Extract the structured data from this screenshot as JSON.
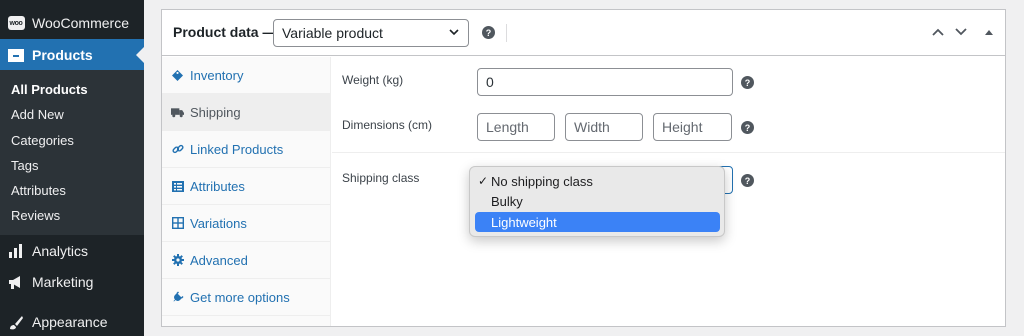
{
  "sidebar": {
    "woocommerce": "WooCommerce",
    "woo_logo_text": "woo",
    "products": "Products",
    "submenu": [
      "All Products",
      "Add New",
      "Categories",
      "Tags",
      "Attributes",
      "Reviews"
    ],
    "analytics": "Analytics",
    "marketing": "Marketing",
    "appearance": "Appearance",
    "active_color": "#2271b1"
  },
  "product_data": {
    "title": "Product data —",
    "type_value": "Variable product",
    "help": "?"
  },
  "tabs": [
    {
      "label": "Inventory",
      "icon": "tag-icon"
    },
    {
      "label": "Shipping",
      "icon": "truck-icon"
    },
    {
      "label": "Linked Products",
      "icon": "link-icon"
    },
    {
      "label": "Attributes",
      "icon": "list-icon"
    },
    {
      "label": "Variations",
      "icon": "grid-icon"
    },
    {
      "label": "Advanced",
      "icon": "gear-icon"
    },
    {
      "label": "Get more options",
      "icon": "plug-icon"
    }
  ],
  "shipping": {
    "weight_label": "Weight (kg)",
    "weight_value": "0",
    "dimensions_label": "Dimensions (cm)",
    "length_placeholder": "Length",
    "width_placeholder": "Width",
    "height_placeholder": "Height",
    "class_label": "Shipping class",
    "help": "?"
  },
  "dropdown": {
    "options": [
      "No shipping class",
      "Bulky",
      "Lightweight"
    ],
    "selected": "No shipping class",
    "checkmark": "✓",
    "highlighted": "Lightweight"
  }
}
